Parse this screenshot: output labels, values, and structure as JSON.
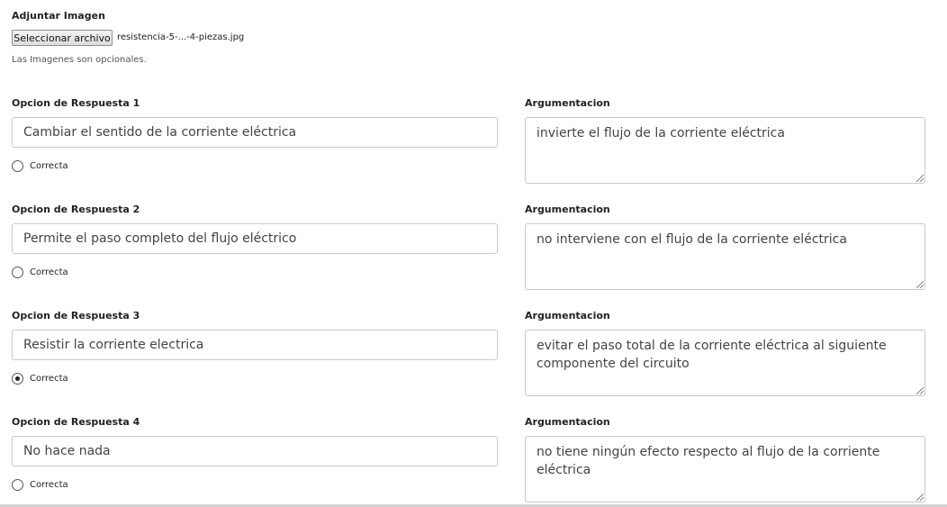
{
  "attachment": {
    "title": "Adjuntar Imagen",
    "button_label": "Seleccionar archivo",
    "file_name": "resistencia-5-...-4-piezas.jpg",
    "help": "Las Imagenes son opcionales."
  },
  "answers": [
    {
      "label": "Opcion de Respuesta 1",
      "value": "Cambiar el sentido de la corriente eléctrica",
      "radio_label": "Correcta",
      "checked": false,
      "arg_label": "Argumentacion",
      "arg_value": "invierte el flujo de la corriente eléctrica"
    },
    {
      "label": "Opcion de Respuesta 2",
      "value": "Permite el paso completo del flujo eléctrico",
      "radio_label": "Correcta",
      "checked": false,
      "arg_label": "Argumentacion",
      "arg_value": "no interviene con el flujo de la corriente eléctrica"
    },
    {
      "label": "Opcion de Respuesta 3",
      "value": "Resistir la corriente electrica",
      "radio_label": "Correcta",
      "checked": true,
      "arg_label": "Argumentacion",
      "arg_value": "evitar el paso total de la corriente eléctrica al siguiente componente del circuito"
    },
    {
      "label": "Opcion de Respuesta 4",
      "value": "No hace nada",
      "radio_label": "Correcta",
      "checked": false,
      "arg_label": "Argumentacion",
      "arg_value": "no tiene ningún efecto respecto al flujo de la corriente eléctrica"
    }
  ]
}
